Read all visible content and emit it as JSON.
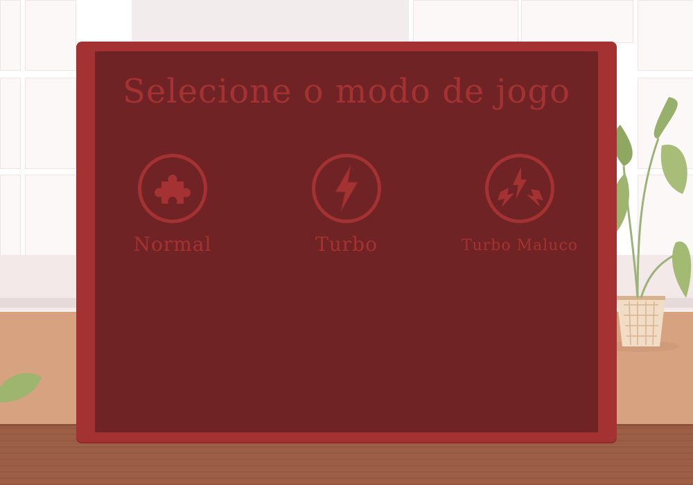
{
  "modal": {
    "title": "Selecione o modo de jogo"
  },
  "modes": [
    {
      "label": "Normal",
      "icon": "puzzle-icon"
    },
    {
      "label": "Turbo",
      "icon": "lightning-icon"
    },
    {
      "label": "Turbo Maluco",
      "icon": "crazy-lightning-icon"
    }
  ],
  "colors": {
    "panel_border": "#a53232",
    "panel_fill": "#702324",
    "text_accent": "#a53232"
  }
}
